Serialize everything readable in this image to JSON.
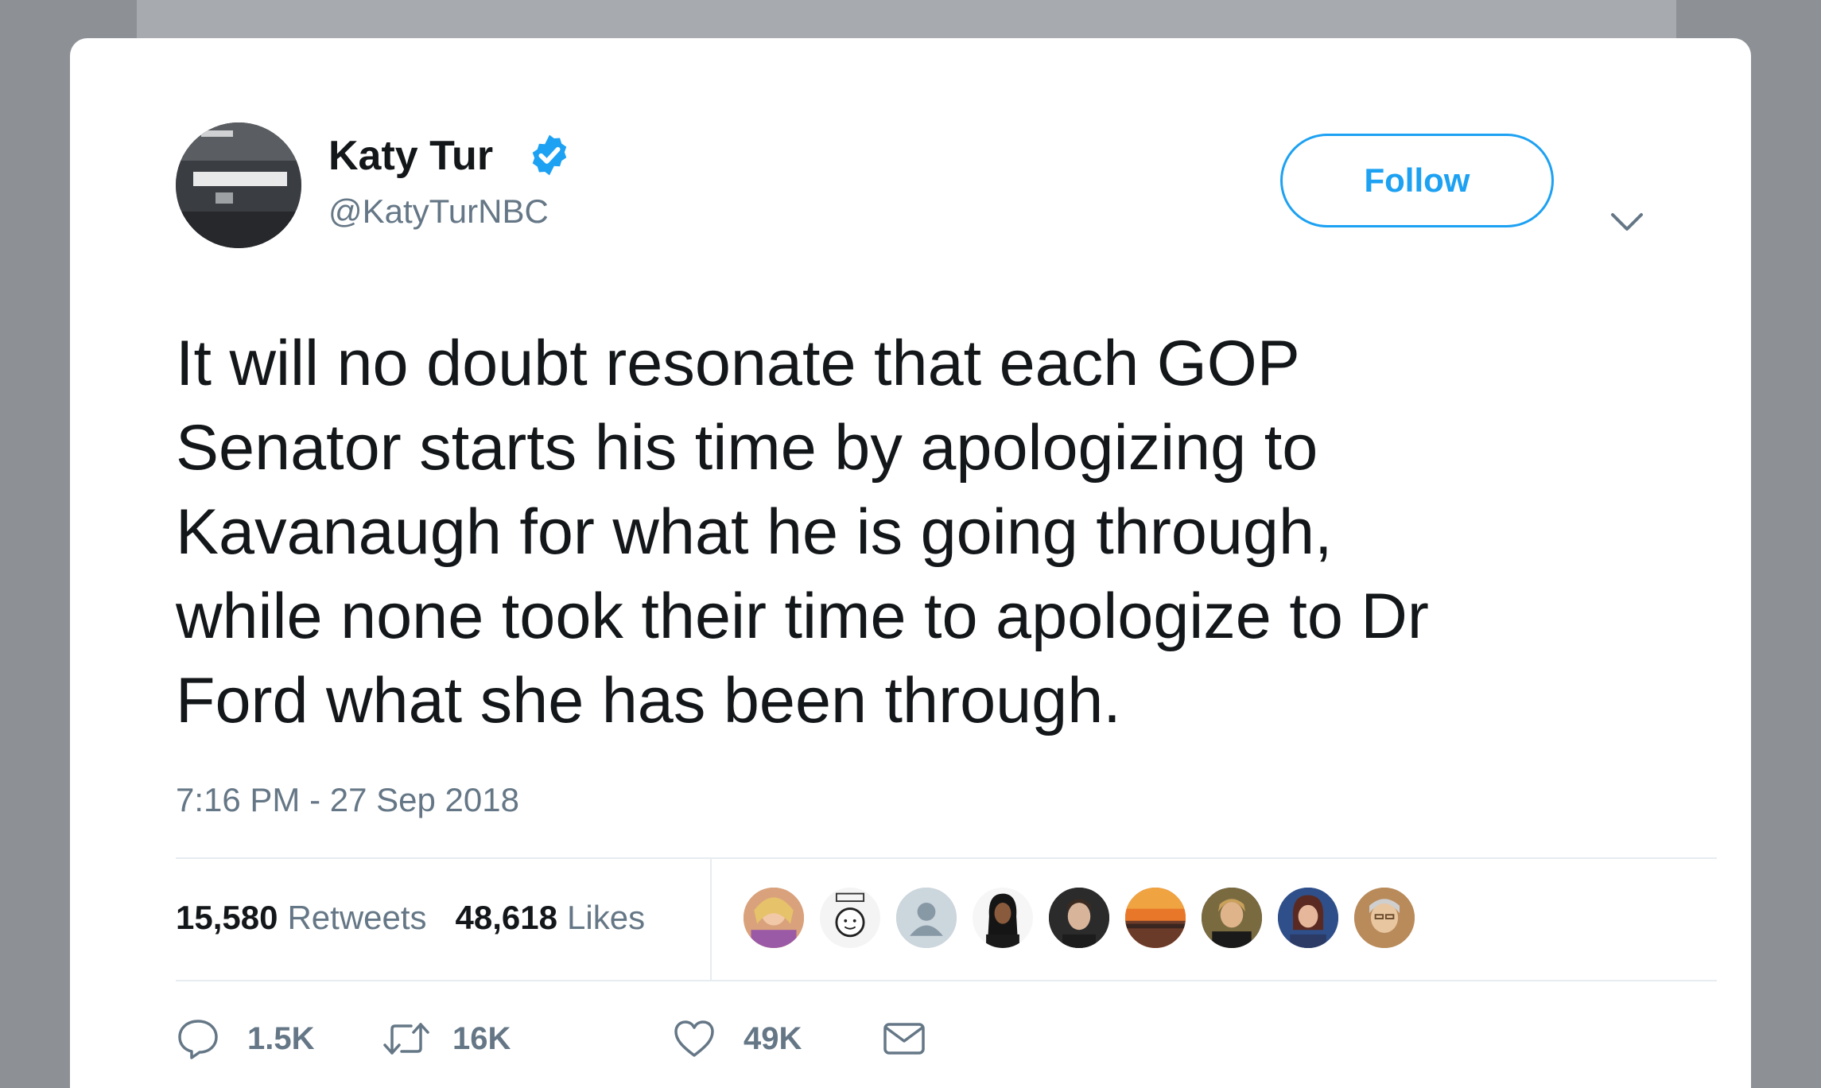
{
  "tweet": {
    "author": {
      "display_name": "Katy Tur",
      "handle": "@KatyTurNBC",
      "verified": true
    },
    "follow_label": "Follow",
    "text_lines": [
      "It will no doubt resonate that each GOP",
      "Senator starts his time by apologizing to",
      "Kavanaugh for what he is going through,",
      "while none took their time to apologize to Dr",
      "Ford what she has been through."
    ],
    "timestamp": "7:16 PM - 27 Sep 2018",
    "stats": {
      "retweets_count": "15,580",
      "retweets_label": "Retweets",
      "likes_count": "48,618",
      "likes_label": "Likes"
    },
    "liker_avatars": [
      "liker-avatar",
      "liker-avatar",
      "default-profile-icon",
      "liker-avatar",
      "liker-avatar",
      "liker-avatar",
      "liker-avatar",
      "liker-avatar",
      "liker-avatar"
    ],
    "actions": {
      "reply_count": "1.5K",
      "retweet_count": "16K",
      "like_count": "49K"
    }
  },
  "colors": {
    "brand_blue": "#1da1f2",
    "text_primary": "#14171a",
    "text_secondary": "#657786",
    "backdrop": "#8d9196"
  }
}
